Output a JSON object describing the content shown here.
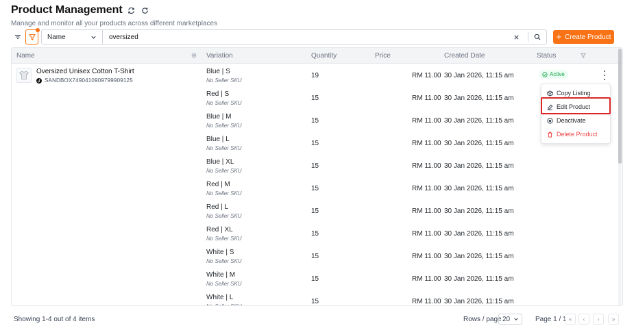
{
  "header": {
    "title": "Product Management",
    "subtitle": "Manage and monitor all your products across different marketplaces"
  },
  "toolbar": {
    "field_select_value": "Name",
    "search_value": "oversized",
    "create_label": "Create Product",
    "accent": "#f97316"
  },
  "table": {
    "columns": {
      "name": "Name",
      "variation": "Variation",
      "quantity": "Quantity",
      "price": "Price",
      "created": "Created Date",
      "status": "Status"
    },
    "product": {
      "name": "Oversized Unisex Cotton T-Shirt",
      "sku": "SANDBOX7490410909799909125",
      "status": "Active"
    },
    "rows": [
      {
        "variation": "Blue | S",
        "sku": "No Seller SKU",
        "quantity": "19",
        "price": "RM 11.00",
        "created": "30 Jan 2026, 11:15 am"
      },
      {
        "variation": "Red | S",
        "sku": "No Seller SKU",
        "quantity": "15",
        "price": "RM 11.00",
        "created": "30 Jan 2026, 11:15 am"
      },
      {
        "variation": "Blue | M",
        "sku": "No Seller SKU",
        "quantity": "15",
        "price": "RM 11.00",
        "created": "30 Jan 2026, 11:15 am"
      },
      {
        "variation": "Blue | L",
        "sku": "No Seller SKU",
        "quantity": "15",
        "price": "RM 11.00",
        "created": "30 Jan 2026, 11:15 am"
      },
      {
        "variation": "Blue | XL",
        "sku": "No Seller SKU",
        "quantity": "15",
        "price": "RM 11.00",
        "created": "30 Jan 2026, 11:15 am"
      },
      {
        "variation": "Red | M",
        "sku": "No Seller SKU",
        "quantity": "15",
        "price": "RM 11.00",
        "created": "30 Jan 2026, 11:15 am"
      },
      {
        "variation": "Red | L",
        "sku": "No Seller SKU",
        "quantity": "15",
        "price": "RM 11.00",
        "created": "30 Jan 2026, 11:15 am"
      },
      {
        "variation": "Red | XL",
        "sku": "No Seller SKU",
        "quantity": "15",
        "price": "RM 11.00",
        "created": "30 Jan 2026, 11:15 am"
      },
      {
        "variation": "White | S",
        "sku": "No Seller SKU",
        "quantity": "15",
        "price": "RM 11.00",
        "created": "30 Jan 2026, 11:15 am"
      },
      {
        "variation": "White | M",
        "sku": "No Seller SKU",
        "quantity": "15",
        "price": "RM 11.00",
        "created": "30 Jan 2026, 11:15 am"
      },
      {
        "variation": "White | L",
        "sku": "No Seller SKU",
        "quantity": "15",
        "price": "RM 11.00",
        "created": "30 Jan 2026, 11:15 am"
      }
    ]
  },
  "action_menu": {
    "copy": "Copy Listing",
    "edit": "Edit Product",
    "deactivate": "Deactivate",
    "delete": "Delete Product"
  },
  "footer": {
    "showing": "Showing 1-4 out of 4 items",
    "rows_label": "Rows / page",
    "rows_value": "20",
    "page_label": "Page 1 / 1"
  }
}
